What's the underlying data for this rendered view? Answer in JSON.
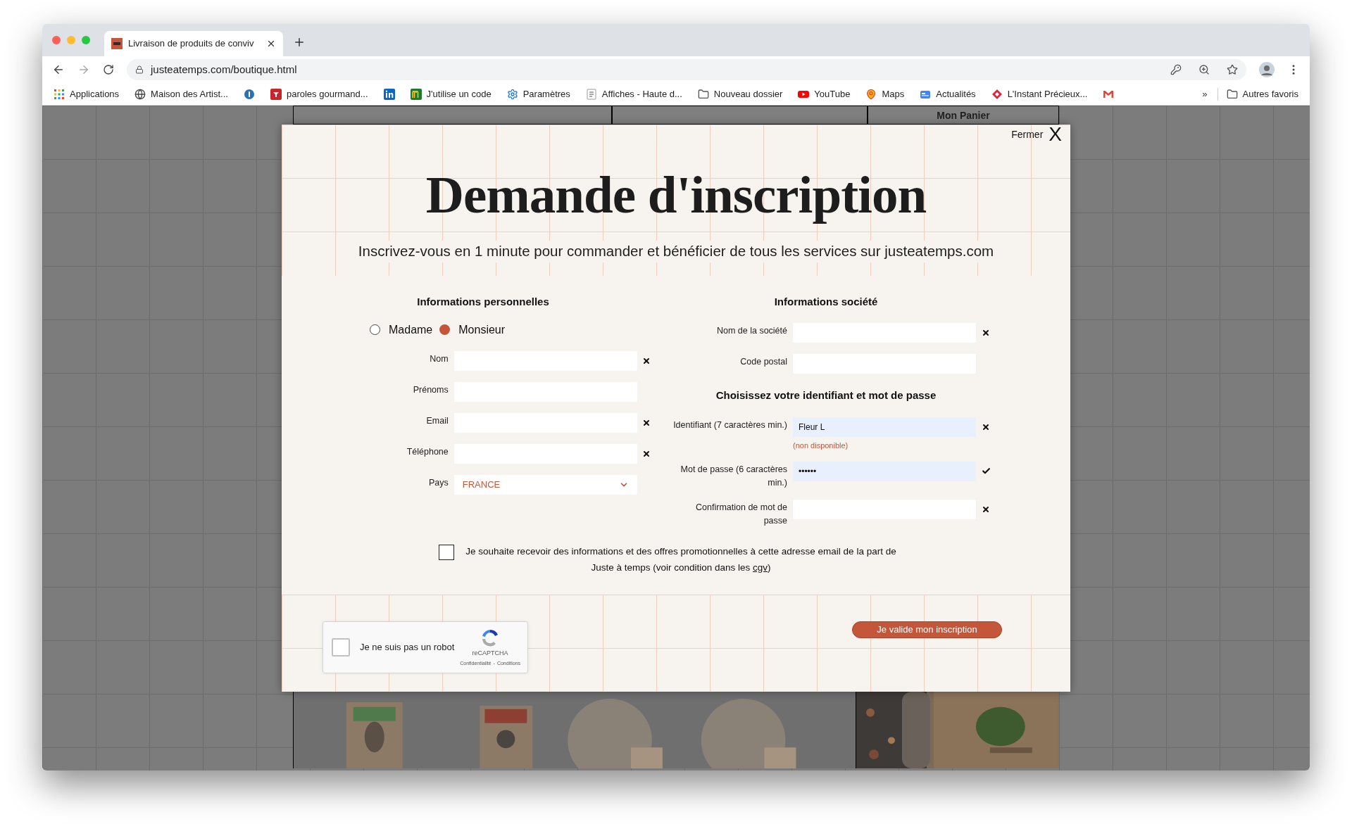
{
  "browser": {
    "tab": {
      "title": "Livraison de produits de conviv",
      "selected": true
    },
    "address": "justeatemps.com/boutique.html",
    "bookmarks": [
      {
        "kind": "apps",
        "label": "Applications"
      },
      {
        "kind": "globe",
        "label": "Maison des Artist..."
      },
      {
        "kind": "badge"
      },
      {
        "kind": "red",
        "label": "paroles gourmand..."
      },
      {
        "kind": "linkedin"
      },
      {
        "kind": "green",
        "label": "J'utilise un code"
      },
      {
        "kind": "gear",
        "label": "Paramètres"
      },
      {
        "kind": "page",
        "label": "Affiches - Haute d..."
      },
      {
        "kind": "folder",
        "label": "Nouveau dossier"
      },
      {
        "kind": "youtube",
        "label": "YouTube"
      },
      {
        "kind": "pin",
        "label": "Maps"
      },
      {
        "kind": "news",
        "label": "Actualités"
      },
      {
        "kind": "diamond",
        "label": "L'Instant Précieux..."
      },
      {
        "kind": "mail"
      }
    ],
    "more": "»",
    "other": "Autres favoris"
  },
  "background": {
    "cart": "Mon Panier"
  },
  "modal": {
    "close_label": "Fermer",
    "close_icon": "X",
    "title": "Demande d'inscription",
    "subtitle": "Inscrivez-vous en 1 minute pour commander et bénéficier de tous les services sur justeatemps.com",
    "personal": {
      "heading": "Informations personnelles",
      "civility": [
        {
          "label": "Madame",
          "selected": false
        },
        {
          "label": "Monsieur",
          "selected": true
        }
      ],
      "fields": [
        {
          "kind": "input",
          "label": "Nom",
          "error": true
        },
        {
          "kind": "input",
          "label": "Prénoms",
          "error": false
        },
        {
          "kind": "input",
          "label": "Email",
          "error": true
        },
        {
          "kind": "input",
          "label": "Téléphone",
          "error": true
        },
        {
          "kind": "select",
          "label": "Pays",
          "value": "FRANCE",
          "error": false
        }
      ]
    },
    "company": {
      "heading": "Informations société",
      "fields": [
        {
          "kind": "input",
          "label": "Nom de la société",
          "error": true
        },
        {
          "kind": "input",
          "label": "Code postal",
          "error": false
        }
      ]
    },
    "credentials": {
      "heading": "Choisissez votre identifiant et mot de passe",
      "fields": [
        {
          "kind": "input",
          "label": "Identifiant (7 caractères min.)",
          "value": "Fleur L",
          "autofilled": true,
          "error": true,
          "note": "(non disponible)"
        },
        {
          "kind": "input",
          "label": "Mot de passe (6 caractères min.)",
          "value": "••••••",
          "autofilled": true,
          "error": false,
          "valid": true
        },
        {
          "kind": "input",
          "label": "Confirmation de mot de passe",
          "autofilled": false,
          "error": true
        }
      ]
    },
    "newsletter": {
      "checked": false,
      "text": "Je souhaite recevoir des informations et des offres promotionnelles à cette adresse email de la part de Juste à temps (voir condition dans les ",
      "link": "cgv",
      "text_after": ")"
    },
    "captcha": {
      "checked": false,
      "label": "Je ne suis pas un robot",
      "brand": "reCAPTCHA",
      "privacy": "Confidentialité",
      "separator": "-",
      "terms": "Conditions"
    },
    "submit": "Je valide mon inscription"
  }
}
